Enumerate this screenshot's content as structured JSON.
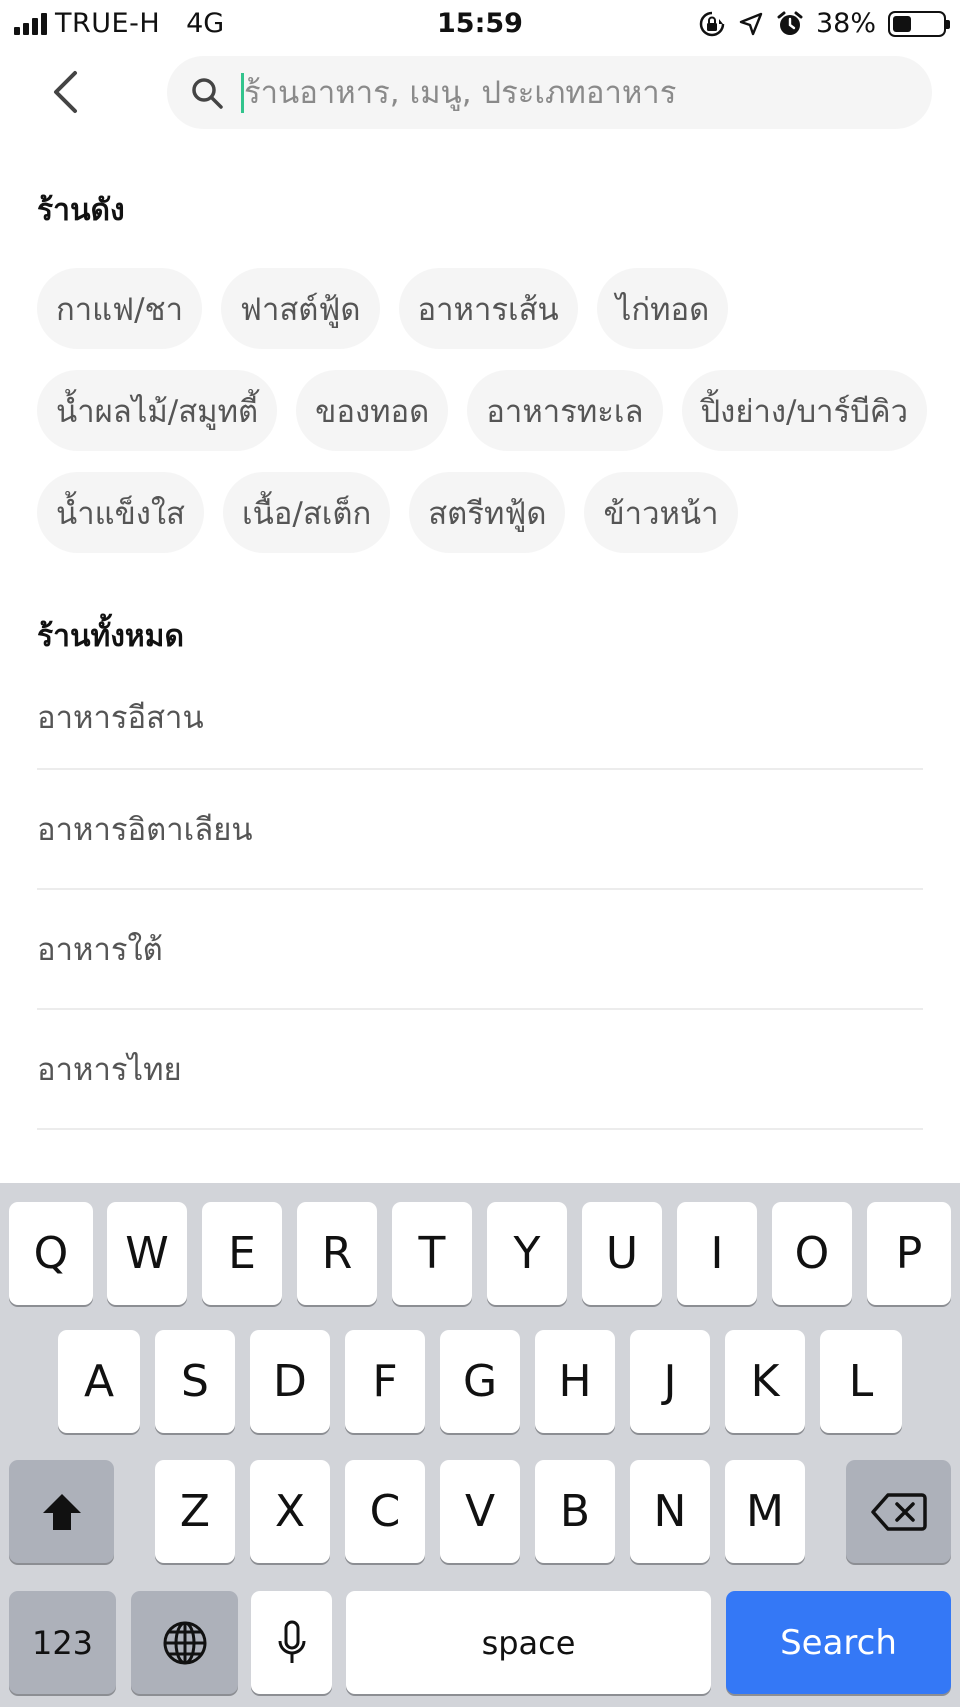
{
  "status_bar": {
    "carrier": "TRUE-H",
    "network": "4G",
    "time": "15:59",
    "battery": "38%",
    "battery_level": 0.38
  },
  "search": {
    "placeholder": "ร้านอาหาร, เมนู, ประเภทอาหาร",
    "value": ""
  },
  "popular": {
    "title": "ร้านดัง",
    "rows": [
      [
        "กาแฟ/ชา",
        "ฟาสต์ฟู้ด",
        "อาหารเส้น",
        "ไก่ทอด"
      ],
      [
        "น้ำผลไม้/สมูทตี้",
        "ของทอด",
        "อาหารทะเล",
        "ปิ้งย่าง/บาร์บีคิว"
      ],
      [
        "น้ำแข็งใส",
        "เนื้อ/สเต็ก",
        "สตรีทฟู้ด",
        "ข้าวหน้า"
      ]
    ]
  },
  "all_stores": {
    "title": "ร้านทั้งหมด",
    "items": [
      "อาหารอีสาน",
      "อาหารอิตาเลียน",
      "อาหารใต้",
      "อาหารไทย"
    ]
  },
  "keyboard": {
    "row1": [
      "Q",
      "W",
      "E",
      "R",
      "T",
      "Y",
      "U",
      "I",
      "O",
      "P"
    ],
    "row2": [
      "A",
      "S",
      "D",
      "F",
      "G",
      "H",
      "J",
      "K",
      "L"
    ],
    "row3": [
      "Z",
      "X",
      "C",
      "V",
      "B",
      "N",
      "M"
    ],
    "numbers_label": "123",
    "space_label": "space",
    "search_label": "Search",
    "search_color": "#3478f6"
  }
}
